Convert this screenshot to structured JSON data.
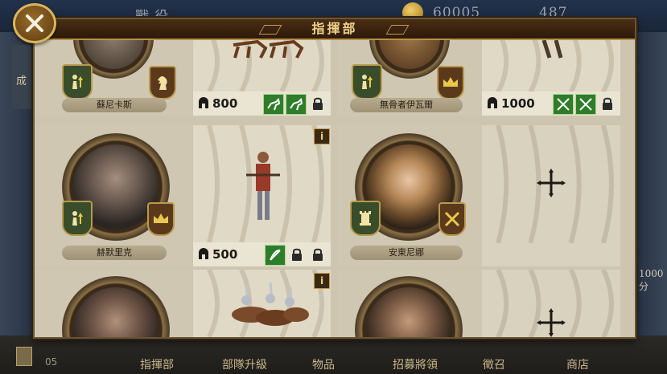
{
  "header": {
    "title": "指揮部",
    "top_left_text": "戰 役",
    "coins": "60005",
    "gems": "487"
  },
  "side": {
    "left_label": "成",
    "right_value": "1000分"
  },
  "bottom_tabs": [
    "指揮部",
    "部隊升級",
    "物品",
    "招募將領",
    "徵召",
    "商店"
  ],
  "bottom_left_count": "05",
  "commanders": [
    {
      "name": "蘇尼卡斯",
      "cost": "800",
      "unit": "cavalry-archers",
      "slots": [
        "active-horse",
        "active-horse",
        "locked"
      ]
    },
    {
      "name": "無骨者伊瓦爾",
      "cost": "1000",
      "unit": "pikemen",
      "slots": [
        "active-sword",
        "active-sword",
        "locked"
      ]
    },
    {
      "name": "赫默里克",
      "cost": "500",
      "unit": "crossbowman",
      "slots": [
        "active-bow",
        "locked",
        "locked"
      ]
    },
    {
      "name": "安東尼娜",
      "cost": "",
      "unit": "empty",
      "slots": []
    },
    {
      "name": "",
      "cost": "",
      "unit": "knights",
      "slots": []
    },
    {
      "name": "",
      "cost": "",
      "unit": "empty",
      "slots": []
    }
  ],
  "colors": {
    "panel": "#cdc5b0",
    "title_bg": "#2c1a0a",
    "title_text": "#f1d48a",
    "slot_active": "#2f7d2a"
  }
}
